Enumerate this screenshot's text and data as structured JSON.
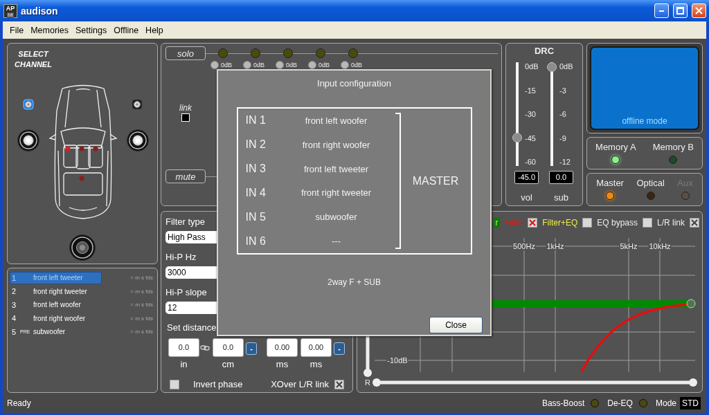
{
  "window": {
    "title": "audison",
    "logo_text": "AP",
    "logo_subtext": "bit"
  },
  "menu": [
    "File",
    "Memories",
    "Settings",
    "Offline",
    "Help"
  ],
  "channel_select": {
    "title": "SELECT CHANNEL",
    "speakers": [
      {
        "kind": "tweeter",
        "selected": true
      },
      {
        "kind": "tweeter",
        "selected": false
      },
      {
        "kind": "woofer",
        "selected": false
      },
      {
        "kind": "woofer",
        "selected": false
      },
      {
        "kind": "woofer",
        "selected": false
      }
    ]
  },
  "channels": [
    {
      "number": "1",
      "name": "front left tweeter",
      "flags": "= m s fds",
      "selected": true
    },
    {
      "number": "2",
      "name": "front right tweeter",
      "flags": "= m s fds",
      "selected": false
    },
    {
      "number": "3",
      "name": "front left woofer",
      "flags": "= m s fds",
      "selected": false
    },
    {
      "number": "4",
      "name": "front right woofer",
      "flags": "= m s fds",
      "selected": false
    },
    {
      "number": "5",
      "tag": "PRE",
      "name": "subwoofer",
      "flags": "= m s fds",
      "selected": false
    }
  ],
  "mixer": {
    "solo_label": "solo",
    "link_label": "link",
    "link_checked": false,
    "mute_label": "mute",
    "inputs": [
      {
        "solo": false,
        "gain": "0dB"
      },
      {
        "solo": false,
        "gain": "0dB"
      },
      {
        "solo": false,
        "gain": "0dB"
      },
      {
        "solo": false,
        "gain": "0dB"
      },
      {
        "solo": false,
        "gain": "0dB"
      }
    ]
  },
  "drc": {
    "title": "DRC",
    "sliders": [
      {
        "label": "vol",
        "reading": "-45.0",
        "level": 0.25,
        "scale": [
          "0dB",
          "-15",
          "-30",
          "-45",
          "-60"
        ]
      },
      {
        "label": "sub",
        "reading": "0.0",
        "level": 1,
        "scale": [
          "0dB",
          "-3",
          "-6",
          "-9",
          "-12"
        ]
      }
    ]
  },
  "display": {
    "text": "offline mode"
  },
  "memories": [
    {
      "label": "Memory A",
      "selected": true
    },
    {
      "label": "Memory B",
      "selected": false
    }
  ],
  "sources": [
    {
      "label": "Master",
      "selected": true,
      "disabled": false
    },
    {
      "label": "Optical",
      "selected": false,
      "disabled": false
    },
    {
      "label": "Aux",
      "selected": false,
      "disabled": true
    }
  ],
  "filter": {
    "fields": [
      {
        "label": "Filter type",
        "value": "High Pass"
      },
      {
        "label": "Hi-P Hz",
        "value": "3000"
      },
      {
        "label": "Hi-P slope",
        "value": "12"
      }
    ],
    "distance_label": "Set distance",
    "distance": [
      {
        "kind": "field",
        "value": "0.0",
        "unit": "in"
      },
      {
        "kind": "link"
      },
      {
        "kind": "field",
        "value": "0.0",
        "unit": "cm"
      },
      {
        "kind": "step",
        "label": "-"
      },
      {
        "kind": "field",
        "value": "0.00",
        "unit": "ms"
      },
      {
        "kind": "field",
        "value": "0.00",
        "unit": "ms"
      },
      {
        "kind": "step",
        "label": "-"
      }
    ],
    "checkboxes": [
      {
        "label": "Invert phase",
        "checked": false
      },
      {
        "label": "XOver L/R link",
        "checked": true
      }
    ]
  },
  "eq": {
    "legend": [
      {
        "kind": "swatch",
        "label": "r",
        "color": "#008000"
      },
      {
        "kind": "toggle",
        "label": "Filter",
        "color": "#e01818",
        "checked": true
      },
      {
        "kind": "toggle",
        "label": "Filter+EQ",
        "color": "#f0f040",
        "checked": false
      },
      {
        "kind": "toggle",
        "label": "EQ bypass",
        "checked": false
      },
      {
        "kind": "toggle",
        "label": "L/R link",
        "checked": true
      }
    ],
    "gain_slider": {
      "level": 0
    },
    "range_slider": {
      "thumbs": [
        {
          "level": 0
        },
        {
          "level": 1
        }
      ]
    },
    "freq_labels": [
      "500Hz",
      "1kHz",
      "5kHz",
      "10kHz"
    ],
    "gain_label": "-10dB",
    "channel_label": "R"
  },
  "status_bar": {
    "text": "Ready",
    "indicators": [
      {
        "label": "Bass-Boost",
        "on": false
      },
      {
        "label": "De-EQ",
        "on": false
      }
    ],
    "mode_label": "Mode",
    "mode_value": "STD"
  },
  "dialog": {
    "title": "Input configuration",
    "inputs": [
      {
        "label": "IN 1",
        "name": "front left woofer"
      },
      {
        "label": "IN 2",
        "name": "front right woofer"
      },
      {
        "label": "IN 3",
        "name": "front left tweeter"
      },
      {
        "label": "IN 4",
        "name": "front right tweeter"
      },
      {
        "label": "IN 5",
        "name": "subwoofer"
      },
      {
        "label": "IN 6",
        "name": "---"
      }
    ],
    "group_label": "MASTER",
    "preset": "2way F + SUB",
    "close_label": "Close"
  }
}
